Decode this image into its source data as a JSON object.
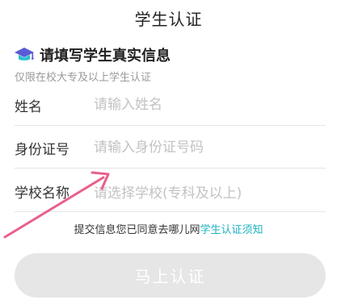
{
  "header": {
    "title": "学生认证"
  },
  "section": {
    "icon": "graduation-cap-icon",
    "title": "请填写学生真实信息",
    "subtitle": "仅限在校大专及以上学生认证"
  },
  "form": {
    "name": {
      "label": "姓名",
      "value": "",
      "placeholder": "请输入姓名"
    },
    "id_number": {
      "label": "身份证号",
      "value": "",
      "placeholder": "请输入身份证号码"
    },
    "school": {
      "label": "学校名称",
      "placeholder": "请选择学校(专科及以上)"
    }
  },
  "agreement": {
    "text": "提交信息您已同意去哪儿网",
    "link": "学生认证须知"
  },
  "submit": {
    "label": "马上认证",
    "enabled": false
  },
  "colors": {
    "link": "#1fb3c4",
    "disabled_button": "#e6e6e6",
    "annotation_arrow": "#e8608a",
    "icon_purple": "#5b5bd6",
    "icon_teal": "#2cc2cf"
  },
  "annotation": {
    "icon": "arrow-annotation"
  }
}
